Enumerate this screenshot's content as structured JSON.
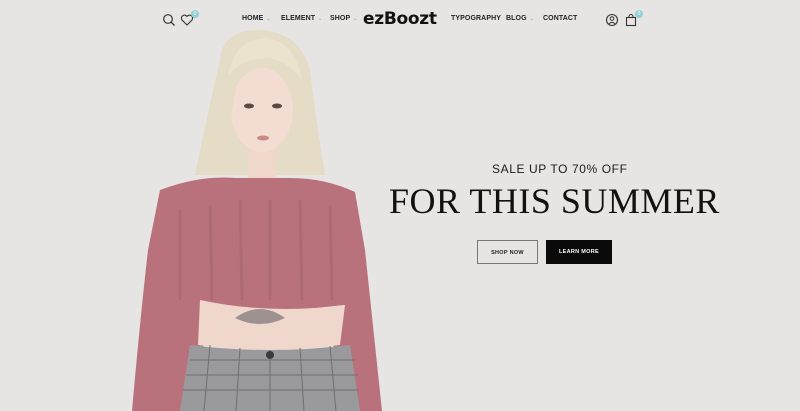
{
  "header": {
    "logo": "ezBoozt",
    "nav_left": [
      {
        "label": "HOME",
        "has_dropdown": true
      },
      {
        "label": "ELEMENT",
        "has_dropdown": true
      },
      {
        "label": "SHOP",
        "has_dropdown": true
      }
    ],
    "nav_right": [
      {
        "label": "TYPOGRAPHY",
        "has_dropdown": false
      },
      {
        "label": "BLOG",
        "has_dropdown": true
      },
      {
        "label": "CONTACT",
        "has_dropdown": false
      }
    ],
    "icons": {
      "search": "search-icon",
      "wishlist": "heart-icon",
      "account": "user-icon",
      "cart": "bag-icon"
    },
    "wishlist_count": "0",
    "cart_count": "0",
    "caret": "⌄"
  },
  "hero": {
    "subtitle": "SALE UP TO 70% OFF",
    "title": "FOR THIS SUMMER",
    "buttons": {
      "shop_now": "SHOP NOW",
      "learn_more": "LEARN MORE"
    }
  },
  "colors": {
    "background": "#e7e5e4",
    "sweater": "#b9727c",
    "accent_badge": "#8fd0d6",
    "button_dark": "#0a0a0a"
  }
}
